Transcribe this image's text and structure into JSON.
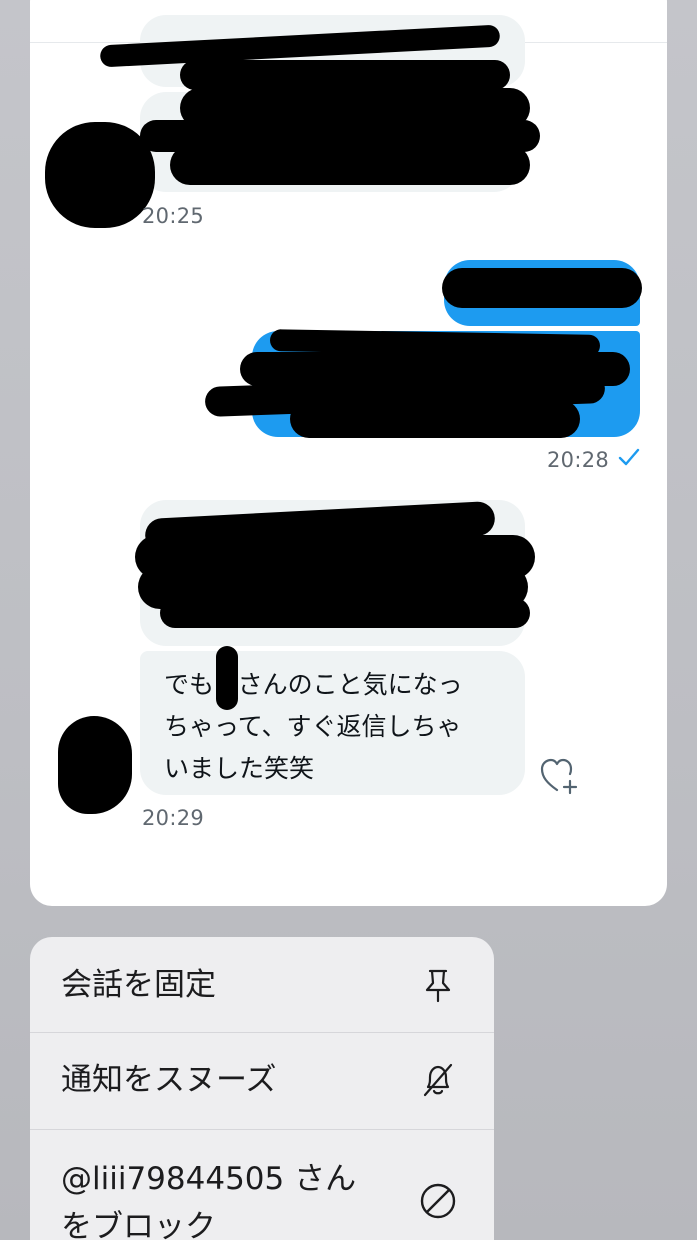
{
  "conversation": {
    "timestamps": {
      "first_incoming": "20:25",
      "outgoing": "20:28",
      "last_incoming": "20:29"
    },
    "last_message_text": "でも■さんのこと気になっ\nちゃって、すぐ返信しちゃ\nいました笑笑",
    "icons": [
      "read-check-icon",
      "like-heart-plus-icon"
    ]
  },
  "context_menu": {
    "items": [
      {
        "label": "会話を固定",
        "icon": "pin-icon"
      },
      {
        "label": "通知をスヌーズ",
        "icon": "bell-slash-icon"
      },
      {
        "label": "@liii79844505 さん\nをブロック",
        "icon": "block-circle-icon"
      }
    ]
  },
  "colors": {
    "outgoing_bubble": "#1d9bf0",
    "incoming_bubble": "#eff3f4",
    "redaction": "#000000"
  }
}
